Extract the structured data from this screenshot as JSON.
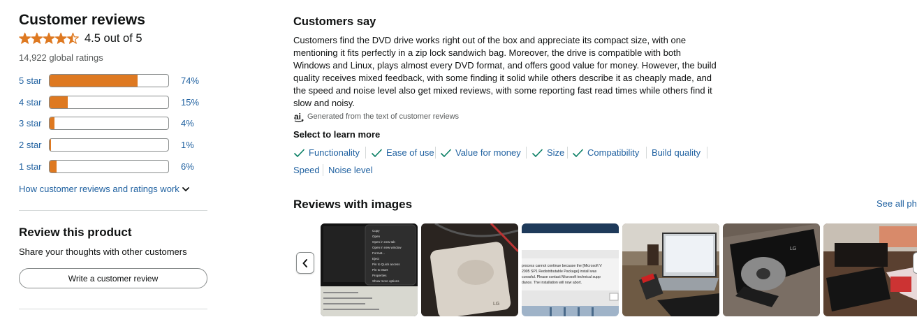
{
  "customer_reviews": {
    "title": "Customer reviews",
    "rating": 4.5,
    "rating_text": "4.5 out of 5",
    "global_ratings": "14,922 global ratings",
    "histogram": [
      {
        "label": "5 star",
        "percent_text": "74%",
        "percent": 74
      },
      {
        "label": "4 star",
        "percent_text": "15%",
        "percent": 15
      },
      {
        "label": "3 star",
        "percent_text": "4%",
        "percent": 4
      },
      {
        "label": "2 star",
        "percent_text": "1%",
        "percent": 1
      },
      {
        "label": "1 star",
        "percent_text": "6%",
        "percent": 6
      }
    ],
    "how_link": "How customer reviews and ratings work",
    "star_color": "#de7921"
  },
  "review_product": {
    "title": "Review this product",
    "subtitle": "Share your thoughts with other customers",
    "button": "Write a customer review"
  },
  "customers_say": {
    "title": "Customers say",
    "summary": "Customers find the DVD drive works right out of the box and appreciate its compact size, with one mentioning it fits perfectly in a zip lock sandwich bag. Moreover, the drive is compatible with both Windows and Linux, plays almost every DVD format, and offers good value for money. However, the build quality receives mixed feedback, with some finding it solid while others describe it as cheaply made, and the speed and noise level also get mixed reviews, with some reporting fast read times while others find it slow and noisy.",
    "ai_badge": "ai",
    "ai_note": "Generated from the text of customer reviews",
    "select_title": "Select to learn more",
    "aspects": [
      {
        "label": "Functionality",
        "positive": true
      },
      {
        "label": "Ease of use",
        "positive": true
      },
      {
        "label": "Value for money",
        "positive": true
      },
      {
        "label": "Size",
        "positive": true
      },
      {
        "label": "Compatibility",
        "positive": true
      },
      {
        "label": "Build quality",
        "positive": false
      },
      {
        "label": "Speed",
        "positive": false
      },
      {
        "label": "Noise level",
        "positive": false
      }
    ]
  },
  "reviews_with_images": {
    "title": "Reviews with images",
    "see_all": "See all photos",
    "thumbnails": [
      "context-menu-photo",
      "lg-drive-photo",
      "install-error-screenshot",
      "laptop-desk-photo",
      "open-drive-tray-photo",
      "drive-on-table-photo"
    ],
    "error_lines": [
      "process cannot continue because the [Microsoft V",
      "2005 SP1 Redistributable Package] install was",
      "ccessful. Please contact Microsoft technical supp",
      "dance. The installation will now abort."
    ],
    "menu_items": [
      "Copy",
      "Open",
      "Open in new tab",
      "Open in new window",
      "Format...",
      "Eject",
      "Pin to Quick access",
      "Pin to Start",
      "Properties",
      "Show more options"
    ],
    "lg_text": "LG"
  }
}
